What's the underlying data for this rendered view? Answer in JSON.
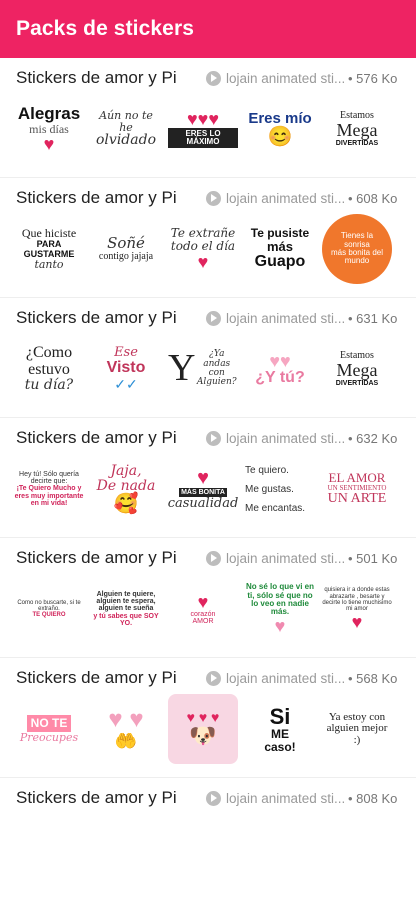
{
  "appbar": {
    "title": "Packs de stickers"
  },
  "packs": [
    {
      "name": "Stickers de amor y Pi",
      "author": "lojain animated sti...",
      "size": "• 576 Ko",
      "stickers": [
        {
          "l1": "Alegras",
          "l2": "mis días"
        },
        {
          "l1": "Aún no te he",
          "l2": "olvidado"
        },
        {
          "l1": "ERES LO MÁXIMO"
        },
        {
          "l1": "Eres mío"
        },
        {
          "l1": "Estamos",
          "l2": "Mega",
          "l3": "DIVERTIDAS"
        }
      ]
    },
    {
      "name": "Stickers de amor y Pi",
      "author": "lojain animated sti...",
      "size": "• 608 Ko",
      "stickers": [
        {
          "l1": "Que hiciste",
          "l2": "PARA GUSTARME",
          "l3": "tanto"
        },
        {
          "l1": "Soñé",
          "l2": "contigo jajaja"
        },
        {
          "l1": "Te extrañe",
          "l2": "todo el día"
        },
        {
          "l1": "Te pusiste",
          "l2": "más",
          "l3": "Guapo"
        },
        {
          "l1": "Tienes la sonrisa",
          "l2": "más bonita del",
          "l3": "mundo"
        }
      ]
    },
    {
      "name": "Stickers de amor y Pi",
      "author": "lojain animated sti...",
      "size": "• 631 Ko",
      "stickers": [
        {
          "l1": "¿Como",
          "l2": "estuvo",
          "l3": "tu día?"
        },
        {
          "l1": "Ese",
          "l2": "Visto"
        },
        {
          "l1": "Y",
          "l2": "¿Ya andas con Alguien?"
        },
        {
          "l1": "¿Y tú?"
        },
        {
          "l1": "Estamos",
          "l2": "Mega",
          "l3": "DIVERTIDAS"
        }
      ]
    },
    {
      "name": "Stickers de amor y Pi",
      "author": "lojain animated sti...",
      "size": "• 632 Ko",
      "stickers": [
        {
          "l1": "Hey tú! Sólo quería decirte que:",
          "l2": "¡Te Quiero Mucho y eres muy importante en mi vida!"
        },
        {
          "l1": "Jaja,",
          "l2": "De nada"
        },
        {
          "l1": "MÁS BONITA",
          "l2": "casualidad"
        },
        {
          "l1": "Te quiero.",
          "l2": "Me gustas.",
          "l3": "Me encantas."
        },
        {
          "l1": "EL AMOR",
          "l2": "UN SENTIMIENTO",
          "l3": "UN ARTE"
        }
      ]
    },
    {
      "name": "Stickers de amor y Pi",
      "author": "lojain animated sti...",
      "size": "• 501 Ko",
      "stickers": [
        {
          "l1": "Como no buscarte, si te extraño.",
          "l2": "TE QUIERO"
        },
        {
          "l1": "Alguien te quiere, alguien te espera, alguien te sueña",
          "l2": "y tú sabes que SOY YO."
        },
        {
          "l1": "corazón",
          "l2": "AMOR"
        },
        {
          "l1": "No sé lo que vi en ti, sólo sé que no lo veo en nadie más."
        },
        {
          "l1": "quisiera ir a donde estas abrazarte , besarte y decirte lo tiene muchisimo mi amor"
        }
      ]
    },
    {
      "name": "Stickers de amor y Pi",
      "author": "lojain animated sti...",
      "size": "• 568 Ko",
      "stickers": [
        {
          "l1": "NO TE",
          "l2": "Preocupes"
        },
        {
          "l1": ""
        },
        {
          "l1": ""
        },
        {
          "l1": "Si",
          "l2": "ME",
          "l3": "caso!"
        },
        {
          "l1": "Ya estoy con",
          "l2": "alguien mejor :)"
        }
      ]
    },
    {
      "name": "Stickers de amor y Pi",
      "author": "lojain animated sti...",
      "size": "• 808 Ko",
      "stickers": []
    }
  ]
}
